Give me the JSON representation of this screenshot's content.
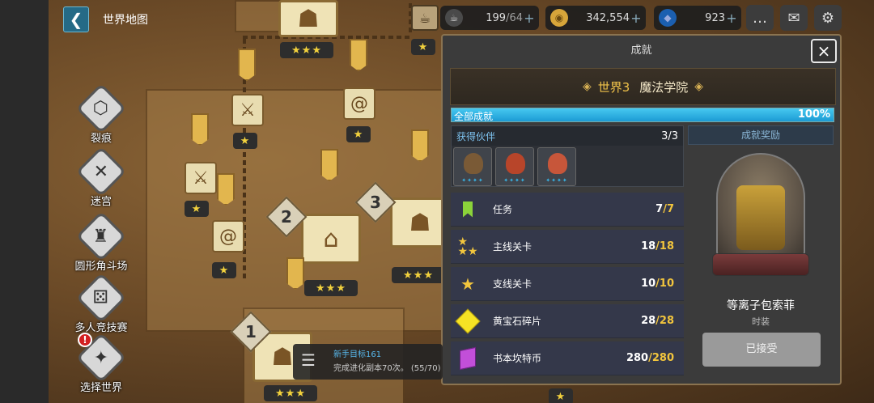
{
  "header": {
    "title": "世界地图",
    "back_icon": "chevron-left-icon"
  },
  "left_menu": [
    {
      "label": "裂痕",
      "icon": "rift-icon"
    },
    {
      "label": "迷宫",
      "icon": "crossed-axes-icon"
    },
    {
      "label": "圆形角斗场",
      "icon": "colosseum-icon"
    },
    {
      "label": "多人竞技赛",
      "icon": "dice-icon"
    },
    {
      "label": "选择世界",
      "icon": "compass-icon"
    }
  ],
  "notification_badge": "!",
  "resources": {
    "coffee": {
      "current": "199",
      "max": "/64"
    },
    "gold": {
      "value": "342,554"
    },
    "gems": {
      "value": "923"
    }
  },
  "map": {
    "stage_numbers": [
      "1",
      "2",
      "3"
    ],
    "star_badges": [
      "★★★",
      "★",
      "★",
      "★",
      "★★★",
      "★★★",
      "★",
      "★★★",
      "★",
      "★"
    ]
  },
  "panel": {
    "title": "成就",
    "close": "×",
    "world_number": "世界3",
    "world_name": "魔法学院",
    "progress_label": "全部成就",
    "progress_percent": "100%",
    "progress_value": 1.0,
    "partners": {
      "label": "获得伙伴",
      "count": "3/3"
    },
    "rows": [
      {
        "name": "任务",
        "current": "7",
        "total": "7",
        "icon": "bookmark-icon",
        "color": "#8bd33a"
      },
      {
        "name": "主线关卡",
        "current": "18",
        "total": "18",
        "icon": "three-stars-icon",
        "color": "#f2c53d"
      },
      {
        "name": "支线关卡",
        "current": "10",
        "total": "10",
        "icon": "star-icon",
        "color": "#f2c53d"
      },
      {
        "name": "黄宝石碎片",
        "current": "28",
        "total": "28",
        "icon": "yellow-gem-icon",
        "color": "#f6e324"
      },
      {
        "name": "书本坎特币",
        "current": "280",
        "total": "280",
        "icon": "purple-book-icon",
        "color": "#c24fd9"
      }
    ],
    "reward": {
      "header": "成就奖励",
      "name": "等离子包索菲",
      "type": "时装",
      "button": "已接受"
    }
  },
  "quest": {
    "menu_icon": "hamburger-icon",
    "title": "新手目标161",
    "desc": "完成进化副本70次。 (55/70)"
  },
  "colors": {
    "accent": "#f1c34a",
    "progress": "#2fb3e6",
    "panel": "#3b3b3b"
  }
}
